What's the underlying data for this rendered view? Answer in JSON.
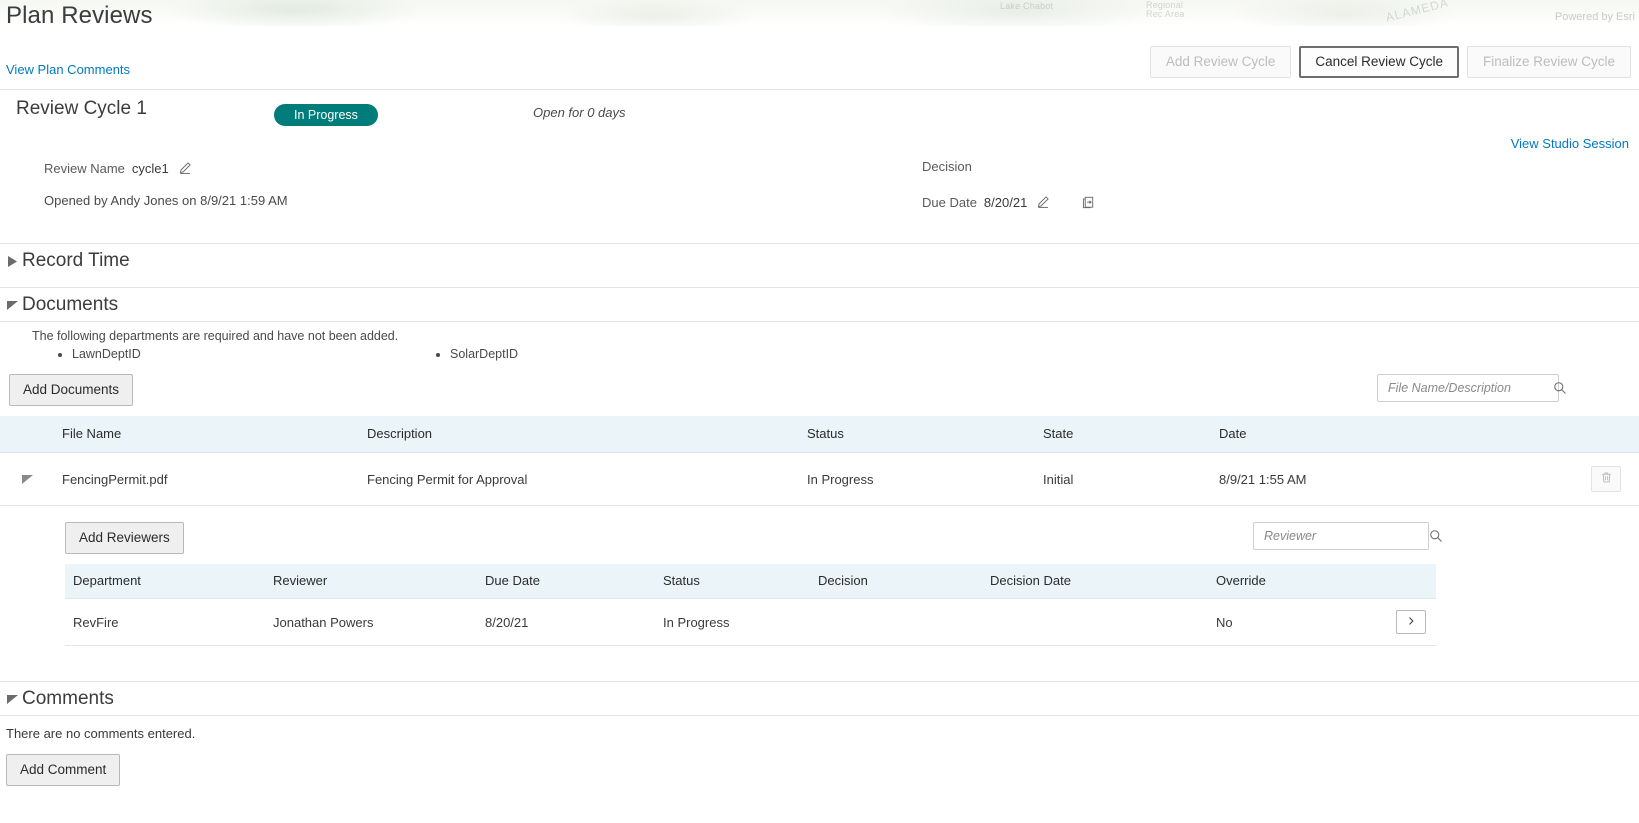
{
  "header": {
    "page_title": "Plan Reviews",
    "plan_comments_link": "View Plan Comments",
    "powered_by": "Powered by Esri",
    "map_labels": {
      "lake": "Lake Chabot",
      "regional": "Regional",
      "rec_area": "Rec Area",
      "county": "ALAMEDA"
    },
    "buttons": {
      "add_review_cycle": "Add Review Cycle",
      "cancel_review_cycle": "Cancel Review Cycle",
      "finalize_review_cycle": "Finalize Review Cycle"
    }
  },
  "cycle": {
    "title": "Review Cycle 1",
    "status": "In Progress",
    "status_color": "#007d7b",
    "open_for": "Open for 0 days",
    "studio_link": "View Studio Session",
    "review_name_label": "Review Name",
    "review_name_value": "cycle1",
    "opened_by": "Opened by Andy Jones on 8/9/21 1:59 AM",
    "decision_label": "Decision",
    "decision_value": "",
    "due_date_label": "Due Date",
    "due_date_value": "8/20/21"
  },
  "sections": {
    "record_time": "Record Time",
    "documents": "Documents",
    "comments": "Comments"
  },
  "documents": {
    "required_note": "The following departments are required and have not been added.",
    "required_depts": [
      "LawnDeptID",
      "SolarDeptID"
    ],
    "add_documents_label": "Add Documents",
    "search_placeholder": "File Name/Description",
    "search_value": "",
    "columns": [
      "File Name",
      "Description",
      "Status",
      "State",
      "Date"
    ],
    "rows": [
      {
        "file_name": "FencingPermit.pdf",
        "description": "Fencing Permit for Approval",
        "status": "In Progress",
        "state": "Initial",
        "date": "8/9/21 1:55 AM"
      }
    ]
  },
  "reviewers": {
    "add_reviewers_label": "Add Reviewers",
    "search_placeholder": "Reviewer",
    "search_value": "",
    "columns": [
      "Department",
      "Reviewer",
      "Due Date",
      "Status",
      "Decision",
      "Decision Date",
      "Override"
    ],
    "rows": [
      {
        "department": "RevFire",
        "reviewer": "Jonathan Powers",
        "due_date": "8/20/21",
        "status": "In Progress",
        "decision": "",
        "decision_date": "",
        "override": "No"
      }
    ]
  },
  "comments": {
    "empty_text": "There are no comments entered.",
    "add_comment_label": "Add Comment"
  }
}
